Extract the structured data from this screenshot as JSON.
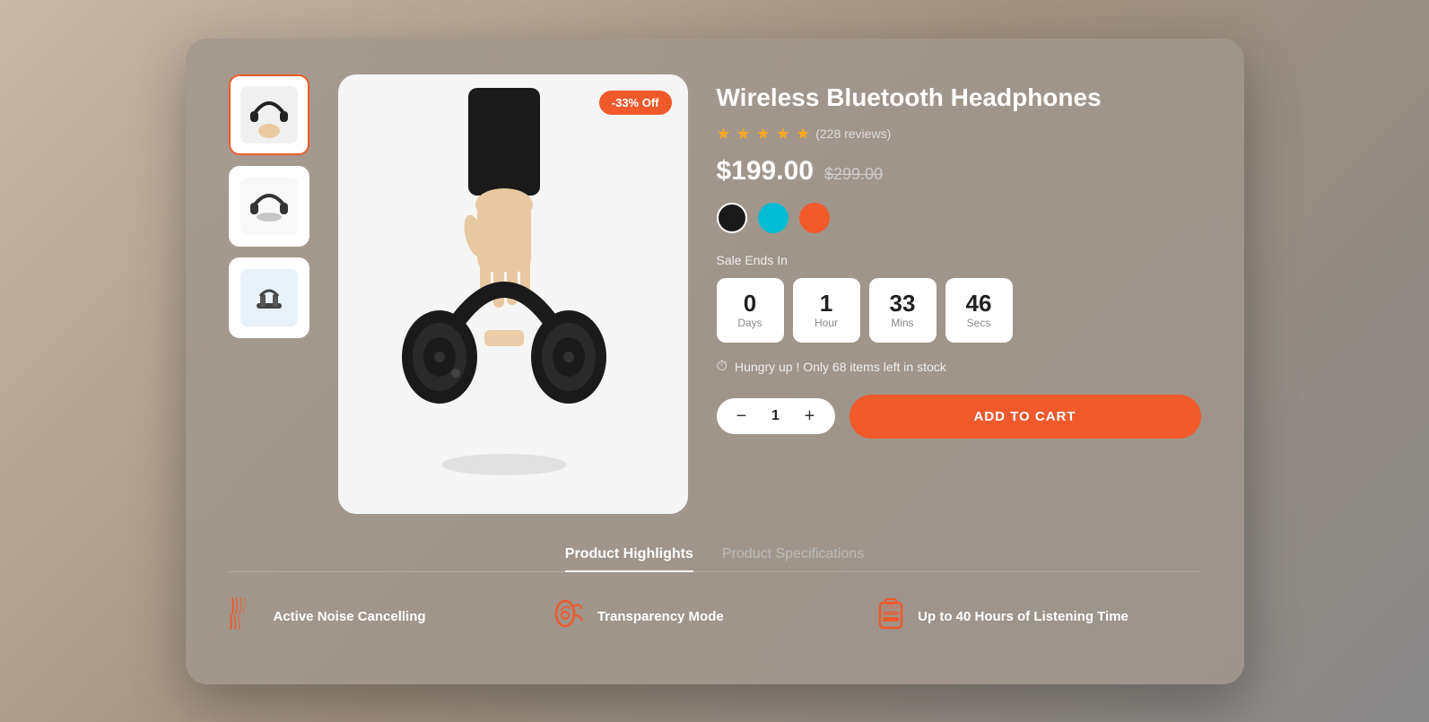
{
  "product": {
    "title": "Wireless Bluetooth Headphones",
    "discount_badge": "-33% Off",
    "price_current": "$199.00",
    "price_original": "$299.00",
    "rating": 4.5,
    "stars": [
      1,
      1,
      1,
      1,
      0.5
    ],
    "review_count": "(228 reviews)",
    "colors": [
      {
        "name": "black",
        "hex": "#1a1a1a",
        "selected": false
      },
      {
        "name": "cyan",
        "hex": "#00bcd4",
        "selected": false
      },
      {
        "name": "red",
        "hex": "#f05a2a",
        "selected": false
      }
    ],
    "sale_label": "Sale Ends In",
    "countdown": {
      "days": {
        "value": "0",
        "label": "Days"
      },
      "hours": {
        "value": "1",
        "label": "Hour"
      },
      "mins": {
        "value": "33",
        "label": "Mins"
      },
      "secs": {
        "value": "46",
        "label": "Secs"
      }
    },
    "stock_notice": "Hungry up ! Only 68 items left in stock",
    "quantity": 1,
    "add_to_cart_label": "ADD TO CART"
  },
  "tabs": [
    {
      "label": "Product Highlights",
      "active": true
    },
    {
      "label": "Product Specifications",
      "active": false
    }
  ],
  "highlights": [
    {
      "icon": "🎵",
      "label": "Active Noise Cancelling"
    },
    {
      "icon": "👂",
      "label": "Transparency Mode"
    },
    {
      "icon": "🔋",
      "label": "Up to 40 Hours of Listening Time"
    }
  ]
}
